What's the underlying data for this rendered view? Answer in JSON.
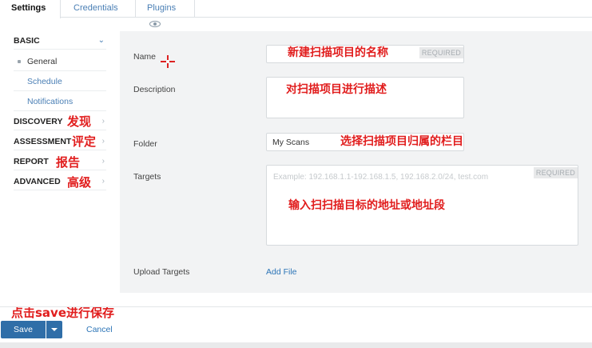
{
  "tabs": {
    "settings": "Settings",
    "credentials": "Credentials",
    "plugins": "Plugins",
    "plugins_icon": "eye-icon"
  },
  "sidebar": {
    "basic": "BASIC",
    "basic_items": [
      "General",
      "Schedule",
      "Notifications"
    ],
    "discovery": "DISCOVERY",
    "assessment": "ASSESSMENT",
    "report": "REPORT",
    "advanced": "ADVANCED",
    "chevron_down": "⌄",
    "chevron_right": "›"
  },
  "form": {
    "name_label": "Name",
    "description_label": "Description",
    "folder_label": "Folder",
    "folder_value": "My Scans",
    "targets_label": "Targets",
    "targets_placeholder": "Example: 192.168.1.1-192.168.1.5, 192.168.2.0/24, test.com",
    "required_badge": "REQUIRED",
    "upload_label": "Upload Targets",
    "add_file": "Add File"
  },
  "annotations": {
    "name_note": "新建扫描项目的名称",
    "description_note": "对扫描项目进行描述",
    "folder_note": "选择扫描项目归属的栏目",
    "targets_note": "输入扫扫描目标的地址或地址段",
    "discovery_note": "发现",
    "assessment_note": "评定",
    "report_note": "报告",
    "advanced_note": "高级",
    "save_note": "点击save进行保存"
  },
  "footer": {
    "save": "Save",
    "cancel": "Cancel"
  },
  "colors": {
    "primary": "#2f6ea8",
    "link": "#2d75b7",
    "annotation": "#e11d1d",
    "panel": "#f2f3f4"
  }
}
